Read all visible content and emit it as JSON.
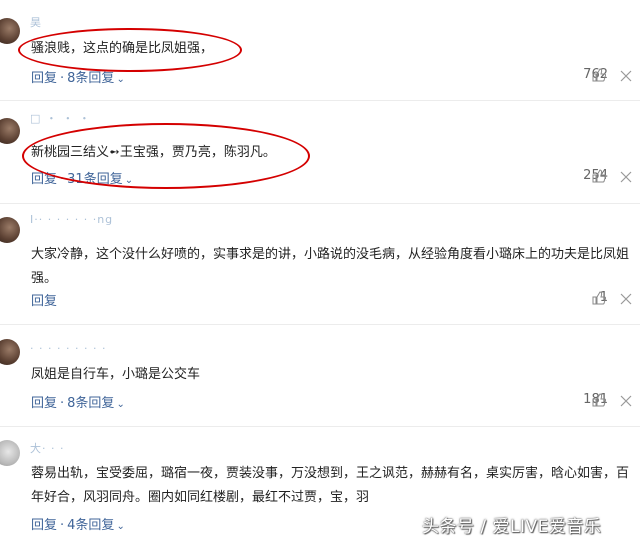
{
  "comments": [
    {
      "text": "骚浪贱，这点的确是比凤姐强，",
      "replies_link": "回复",
      "reply_count": "8条回复",
      "likes": "762"
    },
    {
      "text": "新桃园三结义➻王宝强，贾乃亮，陈羽凡。",
      "replies_link": "回复",
      "reply_count": "31条回复",
      "likes": "254"
    },
    {
      "text": "大家冷静，这个没什么好喷的，实事求是的讲，小路说的没毛病，从经验角度看小璐床上的功夫是比凤姐强。",
      "replies_link": "回复",
      "reply_count": "",
      "likes": "1"
    },
    {
      "text": "凤姐是自行车，小璐是公交车",
      "replies_link": "回复",
      "reply_count": "8条回复",
      "likes": "181"
    },
    {
      "text": "蓉易出轨，宝受委屈，璐宿一夜，贾装没事，万没想到，王之讽范，赫赫有名，桌实厉害，晗心如害，百年好合，风羽同舟。圈内如同红楼剧，最红不过贾，宝，羽",
      "replies_link": "回复",
      "reply_count": "4条回复",
      "likes": ""
    }
  ],
  "icons": {
    "like": "thumb-up-icon",
    "more": "more-icon",
    "expand": "chevron-down-icon"
  },
  "colors": {
    "link": "#406599",
    "annotation": "#d40000"
  },
  "watermark": "头条号 / 爱LIVE爱音乐"
}
